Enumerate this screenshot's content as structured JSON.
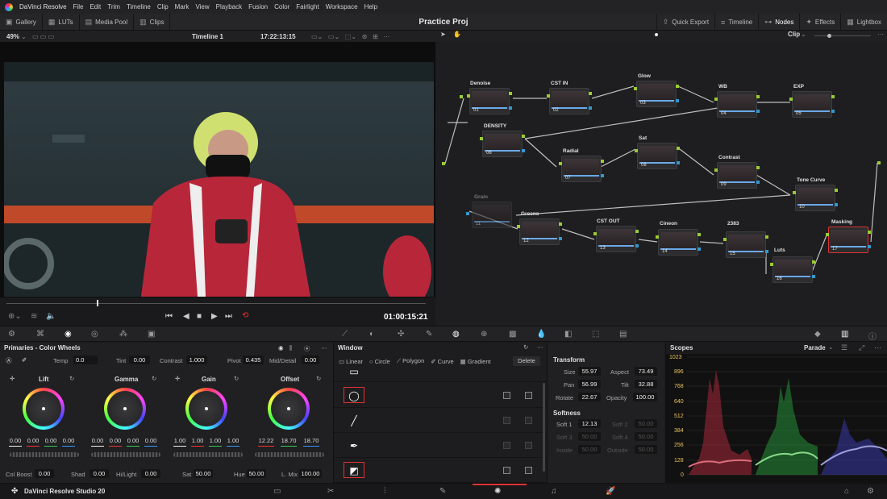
{
  "menubar": {
    "app": "DaVinci Resolve",
    "items": [
      "File",
      "Edit",
      "Trim",
      "Timeline",
      "Clip",
      "Mark",
      "View",
      "Playback",
      "Fusion",
      "Color",
      "Fairlight",
      "Workspace",
      "Help"
    ]
  },
  "toolbar": {
    "gallery": "Gallery",
    "luts": "LUTs",
    "media_pool": "Media Pool",
    "clips": "Clips",
    "project_title": "Practice Proj",
    "quick_export": "Quick Export",
    "timeline": "Timeline",
    "nodes": "Nodes",
    "effects": "Effects",
    "lightbox": "Lightbox"
  },
  "viewer": {
    "zoom": "49%",
    "timeline_name": "Timeline 1",
    "timecode_top": "17:22:13:15",
    "timecode": "01:00:15:21"
  },
  "nodegraph": {
    "mode": "Clip",
    "labels": {
      "denoise": "Denoise",
      "cst_in": "CST IN",
      "glow": "Glow",
      "wb": "WB",
      "exp": "EXP",
      "density": "DENSITY",
      "radial": "Radial",
      "sat": "Sat",
      "contrast": "Contrast",
      "tone_curve": "Tone Curve",
      "grain": "Grain",
      "greens": "Greens",
      "cst_out": "CST OUT",
      "cineon": "Cineon",
      "n2383": "2383",
      "luts": "Luts",
      "masking": "Masking"
    },
    "nums": {
      "n01": "01",
      "n02": "02",
      "n03": "03",
      "n04": "04",
      "n05": "05",
      "n06": "06",
      "n07": "07",
      "n08": "08",
      "n09": "09",
      "n10": "10",
      "n11": "11",
      "n12": "12",
      "n13": "13",
      "n14": "14",
      "n15": "15",
      "n16": "16",
      "n17": "17"
    }
  },
  "primaries": {
    "title": "Primaries - Color Wheels",
    "temp_label": "Temp",
    "temp": "0.0",
    "tint_label": "Tint",
    "tint": "0.00",
    "contrast_label": "Contrast",
    "contrast": "1.000",
    "pivot_label": "Pivot",
    "pivot": "0.435",
    "middetail_label": "Mid/Detail",
    "middetail": "0.00",
    "lift": {
      "title": "Lift",
      "v": [
        "0.00",
        "0.00",
        "0.00",
        "0.00"
      ]
    },
    "gamma": {
      "title": "Gamma",
      "v": [
        "0.00",
        "0.00",
        "0.00",
        "0.00"
      ]
    },
    "gain": {
      "title": "Gain",
      "v": [
        "1.00",
        "1.00",
        "1.00",
        "1.00"
      ]
    },
    "offset": {
      "title": "Offset",
      "v": [
        "12.22",
        "18.70",
        "18.70"
      ]
    },
    "colboost_label": "Col Boost",
    "colboost": "0.00",
    "shad_label": "Shad",
    "shad": "0.00",
    "hilight_label": "Hi/Light",
    "hilight": "0.00",
    "sat_label": "Sat",
    "sat": "50.00",
    "hue_label": "Hue",
    "hue": "50.00",
    "lmix_label": "L. Mix",
    "lmix": "100.00"
  },
  "window": {
    "title": "Window",
    "linear": "Linear",
    "circle": "Circle",
    "polygon": "Polygon",
    "curve": "Curve",
    "gradient": "Gradient",
    "delete": "Delete"
  },
  "transform": {
    "title": "Transform",
    "size_label": "Size",
    "size": "55.97",
    "aspect_label": "Aspect",
    "aspect": "73.49",
    "pan_label": "Pan",
    "pan": "56.99",
    "tilt_label": "Tilt",
    "tilt": "32.88",
    "rotate_label": "Rotate",
    "rotate": "22.67",
    "opacity_label": "Opacity",
    "opacity": "100.00",
    "softness_title": "Softness",
    "soft1_label": "Soft 1",
    "soft1": "12.13",
    "soft2_label": "Soft 2",
    "soft2": "50.00",
    "soft3_label": "Soft 3",
    "soft3": "50.00",
    "soft4_label": "Soft 4",
    "soft4": "50.00",
    "inside_label": "Inside",
    "inside": "50.00",
    "outside_label": "Outside",
    "outside": "50.00"
  },
  "scopes": {
    "title": "Scopes",
    "mode": "Parade",
    "ticks": [
      "1023",
      "896",
      "768",
      "640",
      "512",
      "384",
      "256",
      "128",
      "0"
    ]
  },
  "footer": {
    "app_name": "DaVinci Resolve Studio 20"
  }
}
